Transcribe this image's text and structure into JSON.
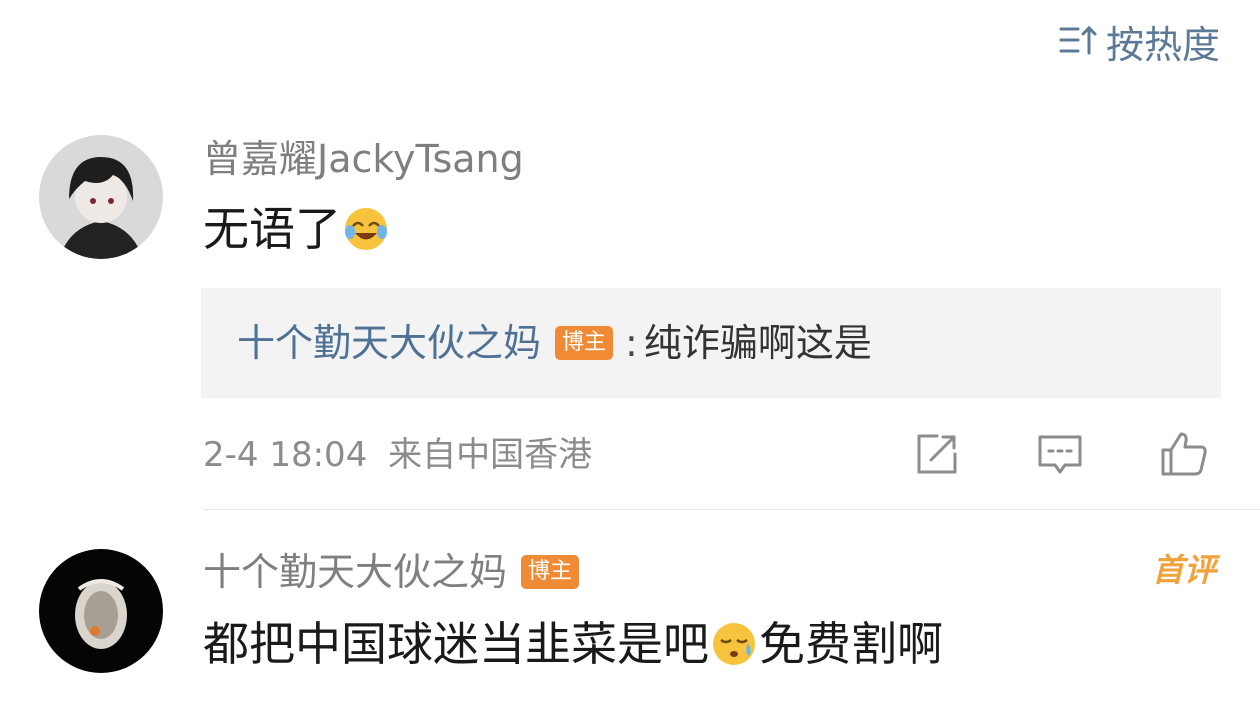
{
  "sort": {
    "label": "按热度",
    "icon": "sort-icon"
  },
  "comments": [
    {
      "username": "曾嘉耀JackyTsang",
      "text_before": "无语了",
      "text_emoji": "laughing-crying-emoji",
      "text_after": "",
      "reply": {
        "user": "十个勤天大伙之妈",
        "badge": "博主",
        "colon": ":",
        "text": "纯诈骗啊这是"
      },
      "timestamp": "2-4 18:04",
      "location": "来自中国香港",
      "actions": [
        "share-icon",
        "comment-icon",
        "like-icon"
      ]
    },
    {
      "username": "十个勤天大伙之妈",
      "badge": "博主",
      "tag": "首评",
      "text_before": "都把中国球迷当韭菜是吧",
      "text_emoji": "sweat-emoji",
      "text_after": "免费割啊"
    }
  ],
  "colors": {
    "link_blue": "#4f7193",
    "badge_orange": "#f08a35",
    "first_tag": "#f0a23b",
    "meta_gray": "#8c8c8c"
  }
}
